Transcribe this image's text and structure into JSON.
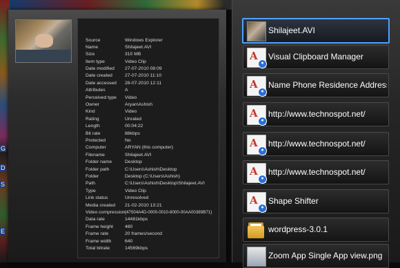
{
  "left_panel": {
    "properties": [
      {
        "key": "Source",
        "value": "Windows Explorer"
      },
      {
        "key": "Name",
        "value": "Shilajeet.AVI"
      },
      {
        "key": "Size",
        "value": "310 MB"
      },
      {
        "key": "Item type",
        "value": "Video Clip"
      },
      {
        "key": "Date modified",
        "value": "27-07-2010 08:09"
      },
      {
        "key": "Date created",
        "value": "27-07-2010 11:10"
      },
      {
        "key": "Date accessed",
        "value": "28-07-2010 12:11"
      },
      {
        "key": "Attributes",
        "value": "A"
      },
      {
        "key": "Perceived type",
        "value": "Video"
      },
      {
        "key": "Owner",
        "value": "Aryan\\Ashish"
      },
      {
        "key": "Kind",
        "value": "Video"
      },
      {
        "key": "Rating",
        "value": "Unrated"
      },
      {
        "key": "Length",
        "value": "00:04:22"
      },
      {
        "key": "Bit rate",
        "value": "88kbps"
      },
      {
        "key": "Protected",
        "value": "No"
      },
      {
        "key": "Computer",
        "value": "ARYAN (this computer)"
      },
      {
        "key": "Filename",
        "value": "Shilajeet.AVI"
      },
      {
        "key": "Folder name",
        "value": "Desktop"
      },
      {
        "key": "Folder path",
        "value": "C:\\Users\\Ashish\\Desktop"
      },
      {
        "key": "Folder",
        "value": "Desktop (C:\\Users\\Ashish)"
      },
      {
        "key": "Path",
        "value": "C:\\Users\\Ashish\\Desktop\\Shilajeet.AVI"
      },
      {
        "key": "Type",
        "value": "Video Clip"
      },
      {
        "key": "Link status",
        "value": "Unresolved"
      },
      {
        "key": "Media created",
        "value": "21-02-2010 13:21"
      },
      {
        "key": "Video compression",
        "value": "{47504A4D-0000-0010-8000-00AA00389B71}"
      },
      {
        "key": "Data rate",
        "value": "14481kbps"
      },
      {
        "key": "Frame height",
        "value": "480"
      },
      {
        "key": "Frame rate",
        "value": "20 frames/second"
      },
      {
        "key": "Frame width",
        "value": "640"
      },
      {
        "key": "Total bitrate",
        "value": "14569kbps"
      }
    ]
  },
  "switcher": {
    "items": [
      {
        "label": "Shilajeet.AVI",
        "icon": "video-thumbnail-icon",
        "selected": true
      },
      {
        "label": "Visual Clipboard Manager",
        "icon": "document-a-icon"
      },
      {
        "label": "Name Phone Residence Address",
        "icon": "document-a-icon"
      },
      {
        "label": "http://www.technospot.net/",
        "icon": "document-a-icon"
      },
      {
        "label": "http://www.technospot.net/",
        "icon": "document-a-icon"
      },
      {
        "label": "http://www.technospot.net/",
        "icon": "document-a-icon"
      },
      {
        "label": "Shape Shifter",
        "icon": "document-a-icon"
      },
      {
        "label": "wordpress-3.0.1",
        "icon": "folder-icon"
      },
      {
        "label": "Zoom App Single App view.png",
        "icon": "image-file-icon"
      }
    ]
  },
  "desktop": {
    "edge_labels": [
      "G",
      "D",
      "S",
      "E"
    ]
  }
}
